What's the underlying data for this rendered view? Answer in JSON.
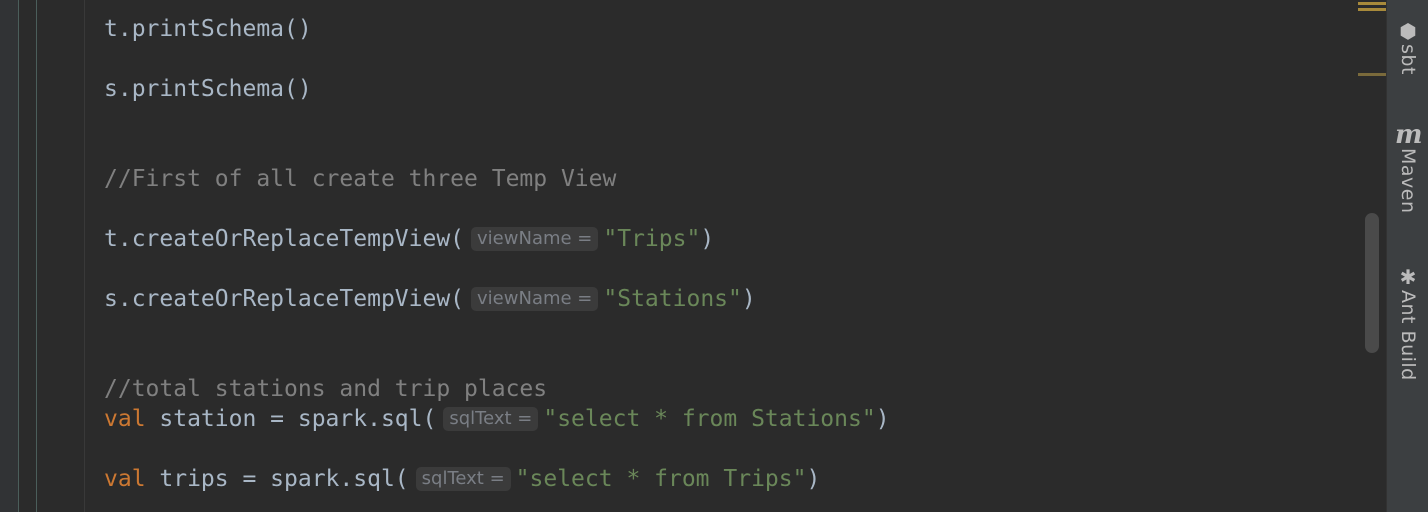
{
  "editor": {
    "lines": [
      {
        "kind": "plain",
        "text": "t.printSchema()"
      },
      {
        "kind": "plain",
        "text": "s.printSchema()"
      },
      {
        "kind": "comment",
        "text": "//First of all create three Temp View"
      },
      {
        "kind": "call_hint",
        "prefix": "t.createOrReplaceTempView(",
        "hint": "viewName =",
        "arg": "\"Trips\"",
        "suffix": ")"
      },
      {
        "kind": "call_hint",
        "prefix": "s.createOrReplaceTempView(",
        "hint": "viewName =",
        "arg": "\"Stations\"",
        "suffix": ")"
      },
      {
        "kind": "comment",
        "text": "//total stations and trip places"
      },
      {
        "kind": "val_hint",
        "keyword": "val",
        "prefix": " station = spark.sql(",
        "hint": "sqlText =",
        "arg": "\"select * from Stations\"",
        "suffix": ")"
      },
      {
        "kind": "val_hint",
        "keyword": "val",
        "prefix": " trips = spark.sql(",
        "hint": "sqlText =",
        "arg": "\"select * from Trips\"",
        "suffix": ")"
      }
    ]
  },
  "tool_windows": [
    {
      "icon": "sbt-icon",
      "glyph": "⬢",
      "label": "sbt"
    },
    {
      "icon": "maven-icon",
      "glyph": "m",
      "label": "Maven"
    },
    {
      "icon": "ant-icon",
      "glyph": "✱",
      "label": "Ant Build"
    }
  ],
  "colors": {
    "background": "#2b2b2b",
    "text": "#a9b7c6",
    "comment": "#808080",
    "keyword": "#cc7832",
    "string": "#6a8759",
    "hint": "#7a7e85"
  }
}
